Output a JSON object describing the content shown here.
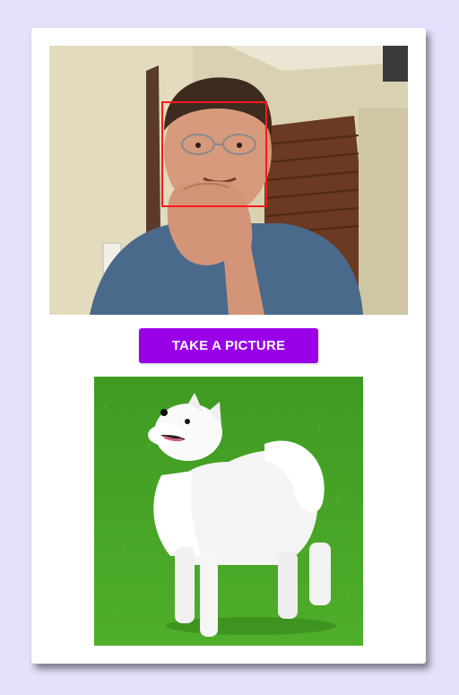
{
  "camera": {
    "subject": "webcam-feed",
    "face_detected": true,
    "face_box_color": "#ff1a1a"
  },
  "button": {
    "label": "TAKE A PICTURE",
    "color": "#9a00e8"
  },
  "photo": {
    "subject": "white-dog-on-grass"
  },
  "colors": {
    "background": "#e4e0fb",
    "card": "#ffffff"
  }
}
